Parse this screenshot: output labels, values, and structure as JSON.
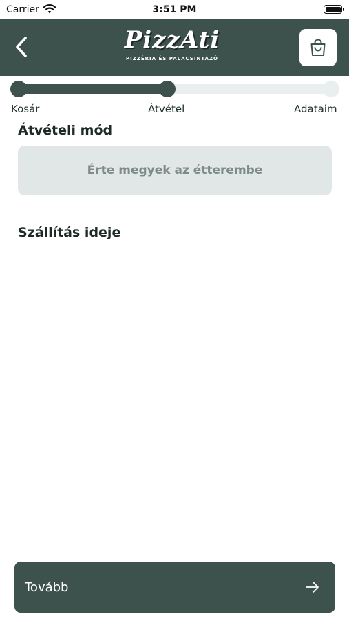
{
  "status_bar": {
    "carrier": "Carrier",
    "time": "3:51 PM",
    "icons": [
      "wifi-icon",
      "battery-icon"
    ]
  },
  "header": {
    "logo_text": "PizzAti",
    "logo_subtitle": "PIZZÉRIA ÉS PALACSINTÁZÓ",
    "icons": [
      "chevron-left-icon",
      "shopping-bag-icon"
    ]
  },
  "stepper": {
    "steps": [
      {
        "label": "Kosár",
        "completed": true
      },
      {
        "label": "Átvétel",
        "completed": true
      },
      {
        "label": "Adataim",
        "completed": false
      }
    ],
    "progress_fraction": 0.5
  },
  "pickup": {
    "title": "Átvételi mód",
    "option_label": "Érte megyek az étterembe"
  },
  "delivery": {
    "title": "Szállítás ideje"
  },
  "continue_button": {
    "label": "Tovább",
    "icon": "arrow-right-icon"
  },
  "colors": {
    "primary": "#3e524d",
    "track": "#e9eeee",
    "option_bg": "#e1e7e7",
    "option_text": "#7d8b8a"
  }
}
